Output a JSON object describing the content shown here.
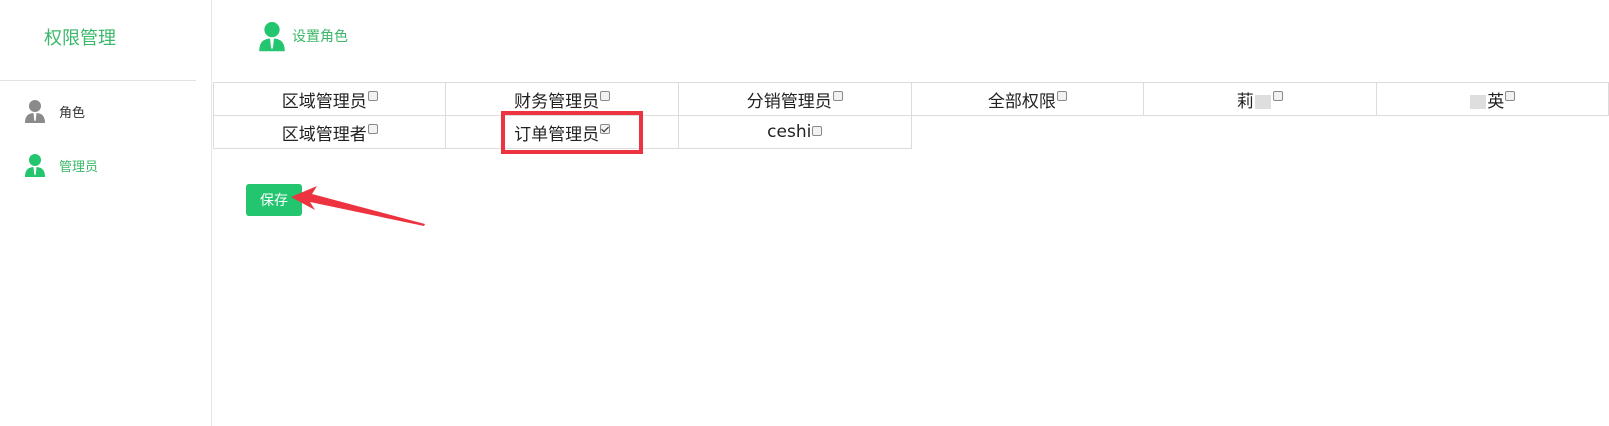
{
  "sidebar": {
    "title": "权限管理",
    "items": [
      {
        "label": "角色",
        "icon": "user-icon",
        "color": "#888888"
      },
      {
        "label": "管理员",
        "icon": "user-icon",
        "color": "#23c56f"
      }
    ]
  },
  "header": {
    "title": "设置角色",
    "icon": "user-icon"
  },
  "roles": [
    [
      {
        "label": "区域管理员",
        "checked": false
      },
      {
        "label": "财务管理员",
        "checked": false
      },
      {
        "label": "分销管理员",
        "checked": false
      },
      {
        "label": "全部权限",
        "checked": false
      },
      {
        "label": "莉",
        "checked": false
      },
      {
        "label": "英",
        "checked": false
      }
    ],
    [
      {
        "label": "区域管理者",
        "checked": false
      },
      {
        "label": "订单管理员",
        "checked": true
      },
      {
        "label": "ceshi",
        "checked": false
      }
    ]
  ],
  "save_label": "保存",
  "colors": {
    "accent": "#23c56f",
    "accent_text": "#3bb86a",
    "highlight": "#ee3340"
  }
}
